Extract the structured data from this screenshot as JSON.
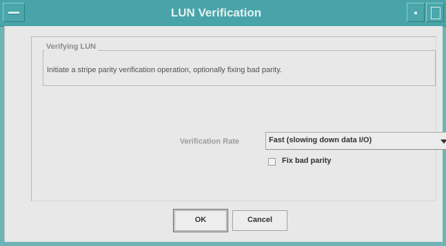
{
  "window": {
    "title": "LUN Verification"
  },
  "group": {
    "title": "Verifying LUN",
    "description": "Initiate a stripe parity verification operation, optionally fixing bad parity."
  },
  "form": {
    "rate_label": "Verification Rate",
    "rate_value": "Fast (slowing down data I/O)",
    "fix_label": "Fix bad parity",
    "fix_checked": false
  },
  "buttons": {
    "ok": "OK",
    "cancel": "Cancel"
  },
  "colors": {
    "titlebar": "#48a4a8",
    "window_border": "#6fb4b4",
    "client_bg": "#e8e8e8"
  }
}
